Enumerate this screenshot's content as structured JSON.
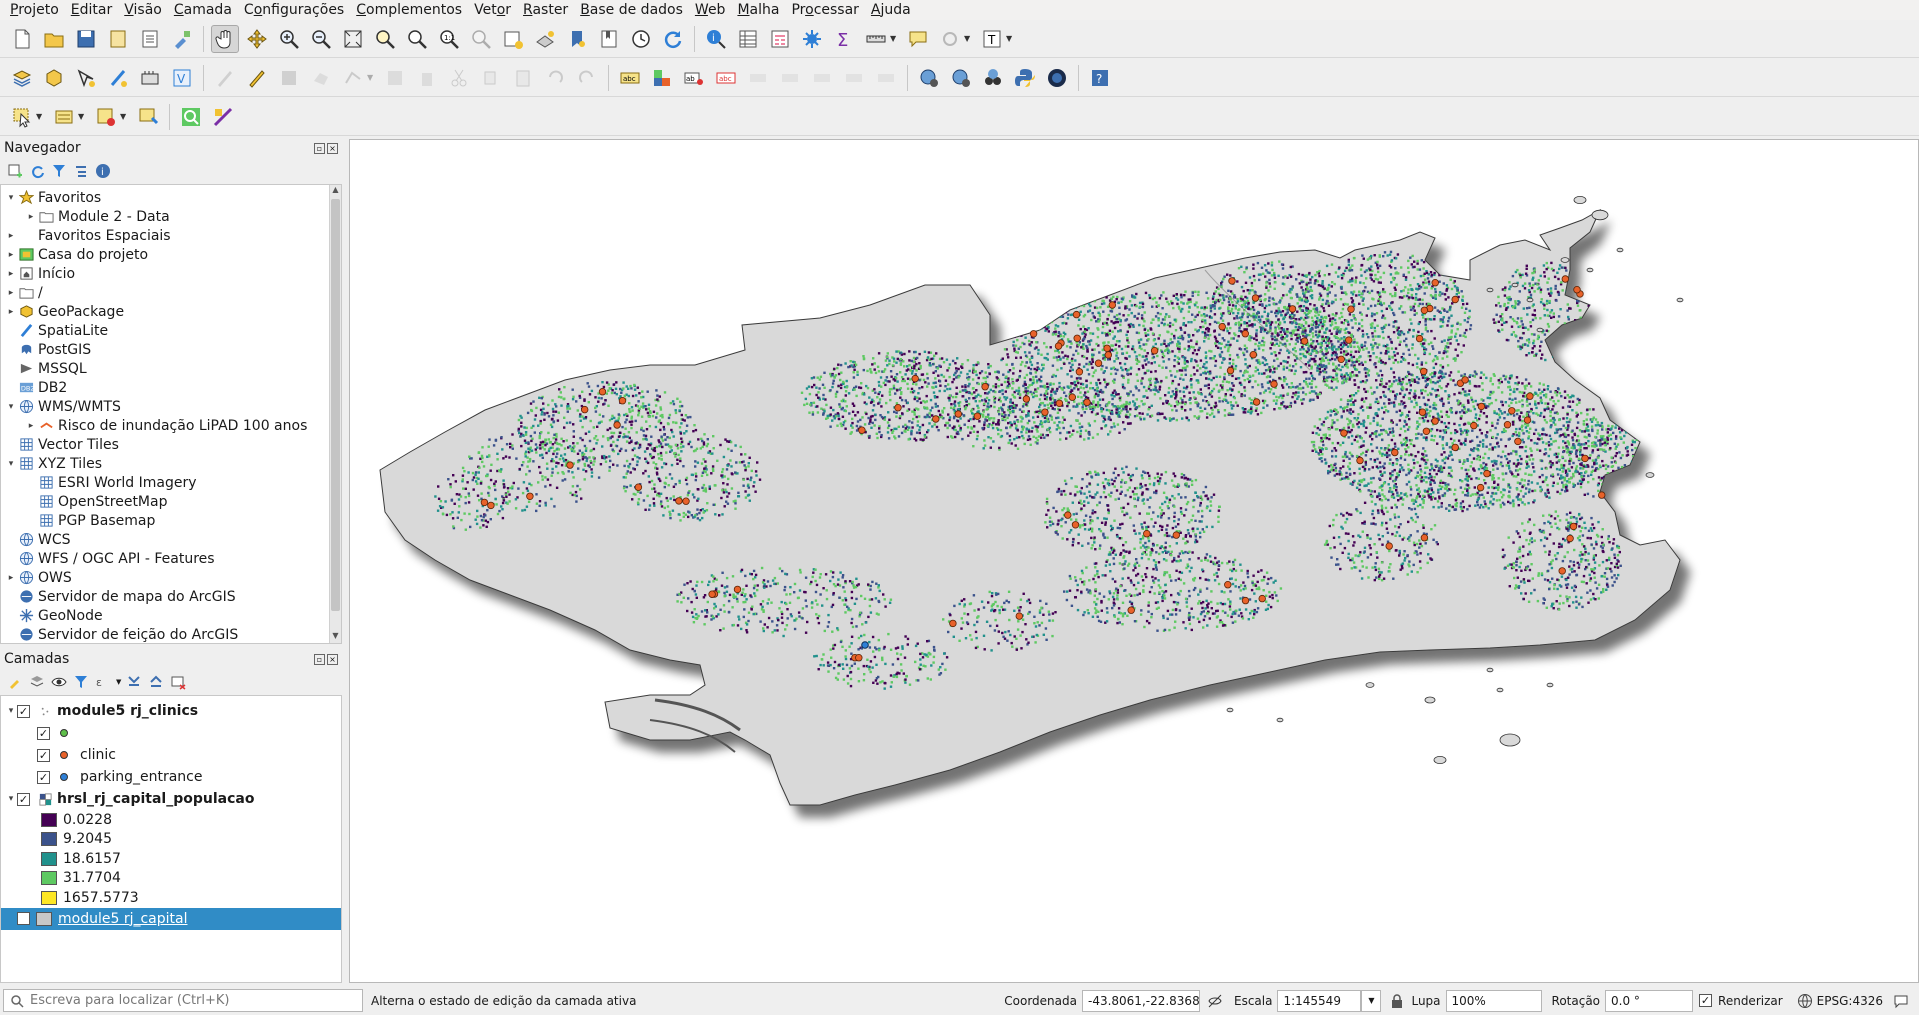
{
  "menu": [
    {
      "pre": "",
      "u": "P",
      "post": "rojeto"
    },
    {
      "pre": "",
      "u": "E",
      "post": "ditar"
    },
    {
      "pre": "",
      "u": "V",
      "post": "isão"
    },
    {
      "pre": "",
      "u": "C",
      "post": "amada"
    },
    {
      "pre": "C",
      "u": "o",
      "post": "nfigurações"
    },
    {
      "pre": "",
      "u": "C",
      "post": "omplementos"
    },
    {
      "pre": "Vet",
      "u": "o",
      "post": "r"
    },
    {
      "pre": "",
      "u": "R",
      "post": "aster"
    },
    {
      "pre": "",
      "u": "B",
      "post": "ase de dados"
    },
    {
      "pre": "",
      "u": "W",
      "post": "eb"
    },
    {
      "pre": "",
      "u": "M",
      "post": "alha"
    },
    {
      "pre": "Pr",
      "u": "o",
      "post": "cessar"
    },
    {
      "pre": "",
      "u": "A",
      "post": "juda"
    }
  ],
  "navigator": {
    "title": "Navegador",
    "items": [
      {
        "label": "Favoritos",
        "icon": "star-icon",
        "expanded": true,
        "indent": 0
      },
      {
        "label": "Module 2 - Data",
        "icon": "folder-icon",
        "expanded": false,
        "indent": 1
      },
      {
        "label": "Favoritos Espaciais",
        "icon": "none",
        "expanded": false,
        "indent": 0
      },
      {
        "label": "Casa do projeto",
        "icon": "project-home-icon",
        "expanded": false,
        "indent": 0
      },
      {
        "label": "Início",
        "icon": "home-icon",
        "expanded": false,
        "indent": 0
      },
      {
        "label": "/",
        "icon": "folder-icon",
        "expanded": false,
        "indent": 0
      },
      {
        "label": "GeoPackage",
        "icon": "geopackage-icon",
        "expanded": false,
        "indent": 0
      },
      {
        "label": "SpatiaLite",
        "icon": "spatialite-icon",
        "expanded": null,
        "indent": 0
      },
      {
        "label": "PostGIS",
        "icon": "postgis-icon",
        "expanded": null,
        "indent": 0
      },
      {
        "label": "MSSQL",
        "icon": "mssql-icon",
        "expanded": null,
        "indent": 0
      },
      {
        "label": "DB2",
        "icon": "db2-icon",
        "expanded": null,
        "indent": 0
      },
      {
        "label": "WMS/WMTS",
        "icon": "globe-icon",
        "expanded": true,
        "indent": 0
      },
      {
        "label": "Risco de inundação LiPAD 100 anos",
        "icon": "wms-layer-icon",
        "expanded": false,
        "indent": 1
      },
      {
        "label": "Vector Tiles",
        "icon": "grid-icon",
        "expanded": null,
        "indent": 0
      },
      {
        "label": "XYZ Tiles",
        "icon": "grid-icon",
        "expanded": true,
        "indent": 0
      },
      {
        "label": "ESRI World Imagery",
        "icon": "grid-icon",
        "expanded": null,
        "indent": 1
      },
      {
        "label": "OpenStreetMap",
        "icon": "grid-icon",
        "expanded": null,
        "indent": 1
      },
      {
        "label": "PGP Basemap",
        "icon": "grid-icon",
        "expanded": null,
        "indent": 1
      },
      {
        "label": "WCS",
        "icon": "globe-icon",
        "expanded": null,
        "indent": 0
      },
      {
        "label": "WFS / OGC API - Features",
        "icon": "globe-icon",
        "expanded": null,
        "indent": 0
      },
      {
        "label": "OWS",
        "icon": "globe-icon",
        "expanded": false,
        "indent": 0
      },
      {
        "label": "Servidor de mapa do ArcGIS",
        "icon": "arcgis-icon",
        "expanded": null,
        "indent": 0
      },
      {
        "label": "GeoNode",
        "icon": "geonode-icon",
        "expanded": null,
        "indent": 0
      },
      {
        "label": "Servidor de feição do ArcGIS",
        "icon": "arcgis-icon",
        "expanded": null,
        "indent": 0
      }
    ]
  },
  "layers": {
    "title": "Camadas",
    "items": [
      {
        "label": "module5 rj_clinics",
        "type": "group",
        "bold": true,
        "indent": 0,
        "expanded": true,
        "checked": true,
        "symbol": "points-icon"
      },
      {
        "label": "",
        "type": "symbol",
        "indent": 1,
        "checked": true,
        "color": "#5fbf4a"
      },
      {
        "label": "clinic",
        "type": "symbol",
        "indent": 1,
        "checked": true,
        "color": "#e8622a"
      },
      {
        "label": "parking_entrance",
        "type": "symbol",
        "indent": 1,
        "checked": true,
        "color": "#2e7fd6"
      },
      {
        "label": "hrsl_rj_capital_populacao",
        "type": "group",
        "bold": true,
        "indent": 0,
        "expanded": true,
        "checked": true,
        "symbol": "raster-icon"
      },
      {
        "label": "0.0228",
        "type": "ramp",
        "indent": 1,
        "color": "#440154"
      },
      {
        "label": "9.2045",
        "type": "ramp",
        "indent": 1,
        "color": "#3b528b"
      },
      {
        "label": "18.6157",
        "type": "ramp",
        "indent": 1,
        "color": "#21918c"
      },
      {
        "label": "31.7704",
        "type": "ramp",
        "indent": 1,
        "color": "#5ec962"
      },
      {
        "label": "1657.5773",
        "type": "ramp",
        "indent": 1,
        "color": "#fde725"
      },
      {
        "label": "module5 rj_capital",
        "type": "polygon",
        "bold": false,
        "indent": 0,
        "checked": true,
        "selected": true,
        "color": "#c8c8c8"
      }
    ]
  },
  "statusbar": {
    "locator_placeholder": "Escreva para localizar (Ctrl+K)",
    "message": "Alterna o estado de edição da camada ativa",
    "coord_label": "Coordenada",
    "coord_value": "-43.8061,-22.8368",
    "scale_label": "Escala",
    "scale_value": "1:145549",
    "magnifier_label": "Lupa",
    "magnifier_value": "100%",
    "rotation_label": "Rotação",
    "rotation_value": "0.0 °",
    "render_label": "Renderizar",
    "crs": "EPSG:4326"
  },
  "map": {
    "polygon_fill": "#d9d9d9",
    "population_colors": [
      "#440154",
      "#3b528b",
      "#21918c",
      "#5ec962"
    ],
    "clinic_color": "#e8622a",
    "parking_color": "#2e7fd6"
  }
}
